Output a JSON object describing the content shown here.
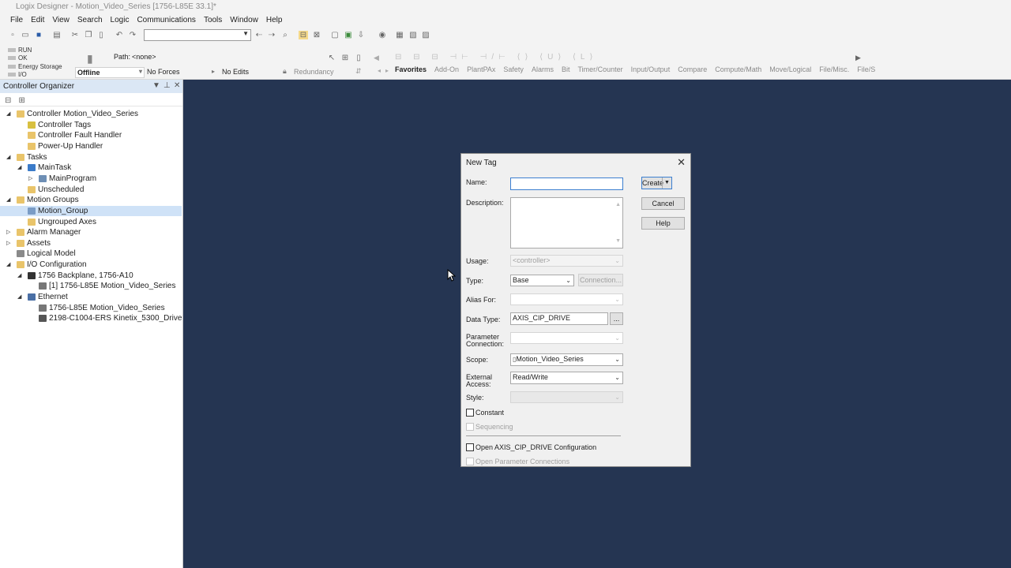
{
  "app": {
    "title": "Logix Designer - Motion_Video_Series [1756-L85E 33.1]*"
  },
  "menu": [
    "File",
    "Edit",
    "View",
    "Search",
    "Logic",
    "Communications",
    "Tools",
    "Window",
    "Help"
  ],
  "status": {
    "indicators": [
      "RUN",
      "OK",
      "Energy Storage",
      "I/O"
    ],
    "path_label": "Path:",
    "path_value": "<none>",
    "mode": "Offline",
    "forces": "No Forces",
    "edits": "No Edits",
    "redundancy": "Redundancy"
  },
  "instruction_tabs": [
    "Favorites",
    "Add-On",
    "PlantPAx",
    "Safety",
    "Alarms",
    "Bit",
    "Timer/Counter",
    "Input/Output",
    "Compare",
    "Compute/Math",
    "Move/Logical",
    "File/Misc.",
    "File/S"
  ],
  "organizer": {
    "title": "Controller Organizer",
    "tree": [
      {
        "label": "Controller Motion_Video_Series",
        "level": 0,
        "expander": "open",
        "icon": "folder-icon"
      },
      {
        "label": "Controller Tags",
        "level": 1,
        "expander": "",
        "icon": "tag-icon"
      },
      {
        "label": "Controller Fault Handler",
        "level": 1,
        "expander": "",
        "icon": "folder-icon"
      },
      {
        "label": "Power-Up Handler",
        "level": 1,
        "expander": "",
        "icon": "folder-icon"
      },
      {
        "label": "Tasks",
        "level": 0,
        "expander": "open",
        "icon": "folder-icon"
      },
      {
        "label": "MainTask",
        "level": 1,
        "expander": "open",
        "icon": "task-icon"
      },
      {
        "label": "MainProgram",
        "level": 2,
        "expander": "closed",
        "icon": "program-icon"
      },
      {
        "label": "Unscheduled",
        "level": 1,
        "expander": "",
        "icon": "folder-icon"
      },
      {
        "label": "Motion Groups",
        "level": 0,
        "expander": "open",
        "icon": "folder-icon"
      },
      {
        "label": "Motion_Group",
        "level": 1,
        "expander": "",
        "icon": "motion-group-icon",
        "selected": true
      },
      {
        "label": "Ungrouped Axes",
        "level": 1,
        "expander": "",
        "icon": "folder-icon"
      },
      {
        "label": "Alarm Manager",
        "level": 0,
        "expander": "closed",
        "icon": "folder-icon"
      },
      {
        "label": "Assets",
        "level": 0,
        "expander": "closed",
        "icon": "folder-icon"
      },
      {
        "label": "Logical Model",
        "level": 0,
        "expander": "",
        "icon": "model-icon"
      },
      {
        "label": "I/O Configuration",
        "level": 0,
        "expander": "open",
        "icon": "folder-icon"
      },
      {
        "label": "1756 Backplane, 1756-A10",
        "level": 1,
        "expander": "open",
        "icon": "backplane-icon"
      },
      {
        "label": "[1] 1756-L85E Motion_Video_Series",
        "level": 2,
        "expander": "",
        "icon": "controller-icon"
      },
      {
        "label": "Ethernet",
        "level": 1,
        "expander": "open",
        "icon": "network-icon"
      },
      {
        "label": "1756-L85E Motion_Video_Series",
        "level": 2,
        "expander": "",
        "icon": "controller-icon"
      },
      {
        "label": "2198-C1004-ERS Kinetix_5300_Drive",
        "level": 2,
        "expander": "",
        "icon": "drive-icon"
      }
    ]
  },
  "dialog": {
    "title": "New Tag",
    "name_label": "Name:",
    "name_value": "",
    "description_label": "Description:",
    "usage_label": "Usage:",
    "usage_value": "<controller>",
    "type_label": "Type:",
    "type_value": "Base",
    "connection_button": "Connection...",
    "alias_label": "Alias For:",
    "datatype_label": "Data Type:",
    "datatype_value": "AXIS_CIP_DRIVE",
    "browse_button": "...",
    "param_label_1": "Parameter",
    "param_label_2": "Connection:",
    "scope_label": "Scope:",
    "scope_value": "Motion_Video_Series",
    "external_label_1": "External",
    "external_label_2": "Access:",
    "external_value": "Read/Write",
    "style_label": "Style:",
    "constant_label": "Constant",
    "sequencing_label": "Sequencing",
    "open_config_label": "Open AXIS_CIP_DRIVE Configuration",
    "open_param_label": "Open Parameter Connections",
    "create_button": "Create",
    "cancel_button": "Cancel",
    "help_button": "Help"
  }
}
